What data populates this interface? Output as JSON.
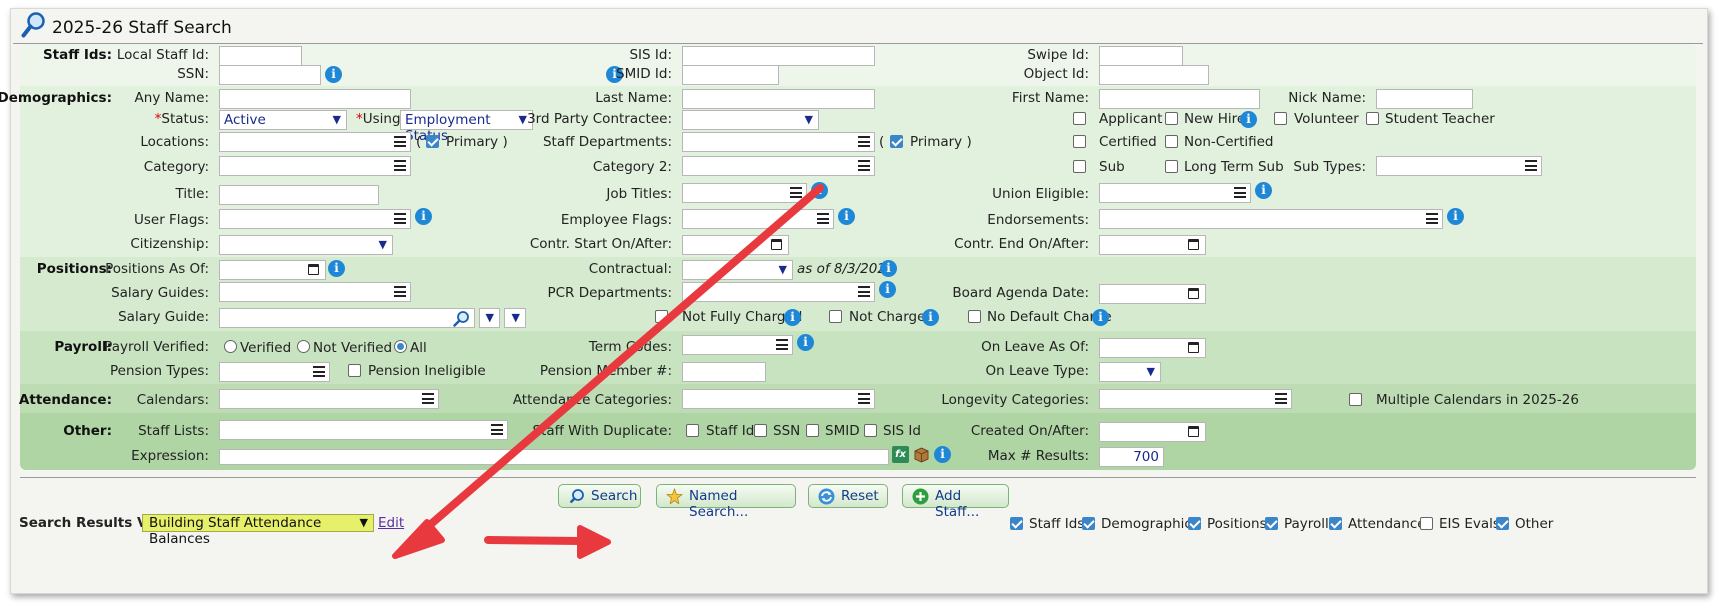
{
  "title": "2025-26 Staff Search",
  "sections": {
    "staff_ids": "Staff Ids:",
    "demographics": "Demographics:",
    "positions": "Positions:",
    "payroll": "Payroll:",
    "attendance": "Attendance:",
    "other": "Other:"
  },
  "labels": {
    "local_staff_id": "Local Staff Id:",
    "ssn": "SSN:",
    "sis_id": "SIS Id:",
    "smid_id": "SMID Id:",
    "swipe_id": "Swipe Id:",
    "object_id": "Object Id:",
    "any_name": "Any Name:",
    "last_name": "Last Name:",
    "first_name": "First Name:",
    "nick_name": "Nick Name:",
    "status": "Status:",
    "using": "Using:",
    "third_party": "3rd Party Contractee:",
    "locations": "Locations:",
    "staff_departments": "Staff Departments:",
    "category": "Category:",
    "category2": "Category 2:",
    "title": "Title:",
    "job_titles": "Job Titles:",
    "union_eligible": "Union Eligible:",
    "user_flags": "User Flags:",
    "employee_flags": "Employee Flags:",
    "endorsements": "Endorsements:",
    "citizenship": "Citizenship:",
    "contr_start": "Contr. Start On/After:",
    "contr_end": "Contr. End On/After:",
    "positions_as_of": "Positions As Of:",
    "contractual": "Contractual:",
    "as_of": "as of 8/3/2025",
    "salary_guides": "Salary Guides:",
    "pcr_departments": "PCR Departments:",
    "board_agenda_date": "Board Agenda Date:",
    "salary_guide": "Salary Guide:",
    "payroll_verified": "Payroll Verified:",
    "term_codes": "Term Codes:",
    "on_leave_as_of": "On Leave As Of:",
    "pension_types": "Pension Types:",
    "pension_member": "Pension Member #:",
    "on_leave_type": "On Leave Type:",
    "calendars": "Calendars:",
    "attendance_categories": "Attendance Categories:",
    "longevity_categories": "Longevity Categories:",
    "staff_lists": "Staff Lists:",
    "staff_with_duplicate": "Staff With Duplicate:",
    "created_on_after": "Created On/After:",
    "expression": "Expression:",
    "max_results": "Max # Results:",
    "sub_types": "Sub Types:",
    "search_results_view": "Search Results View:"
  },
  "values": {
    "status": "Active",
    "using": "Employment Status",
    "max_results": "700",
    "results_view": "Building Staff Attendance Balances"
  },
  "options": {
    "primary": "Primary",
    "applicant": "Applicant",
    "new_hire": "New Hire",
    "volunteer": "Volunteer",
    "student_teacher": "Student Teacher",
    "certified": "Certified",
    "non_certified": "Non-Certified",
    "sub": "Sub",
    "long_term_sub": "Long Term Sub",
    "not_fully_charged": "Not Fully Charged",
    "not_charged": "Not Charged",
    "no_default_charge": "No Default Charge",
    "verified": "Verified",
    "not_verified": "Not Verified",
    "all": "All",
    "pension_ineligible": "Pension Ineligible",
    "multiple_calendars": "Multiple Calendars in 2025-26",
    "dup_staff_id": "Staff Id",
    "dup_ssn": "SSN",
    "dup_smid": "SMID",
    "dup_sis_id": "SIS Id"
  },
  "buttons": {
    "search": "Search",
    "named_search": "Named Search...",
    "reset": "Reset",
    "add_staff": "Add Staff...",
    "edit": "Edit"
  },
  "footer_checks": [
    "Staff Ids",
    "Demographics",
    "Positions",
    "Payroll",
    "Attendance",
    "EIS Evals",
    "Other"
  ],
  "colors": {
    "accent": "#3a86c8",
    "info": "#1f88d6",
    "results_view_bg": "#e7f06a",
    "arrow": "#e8393f"
  }
}
